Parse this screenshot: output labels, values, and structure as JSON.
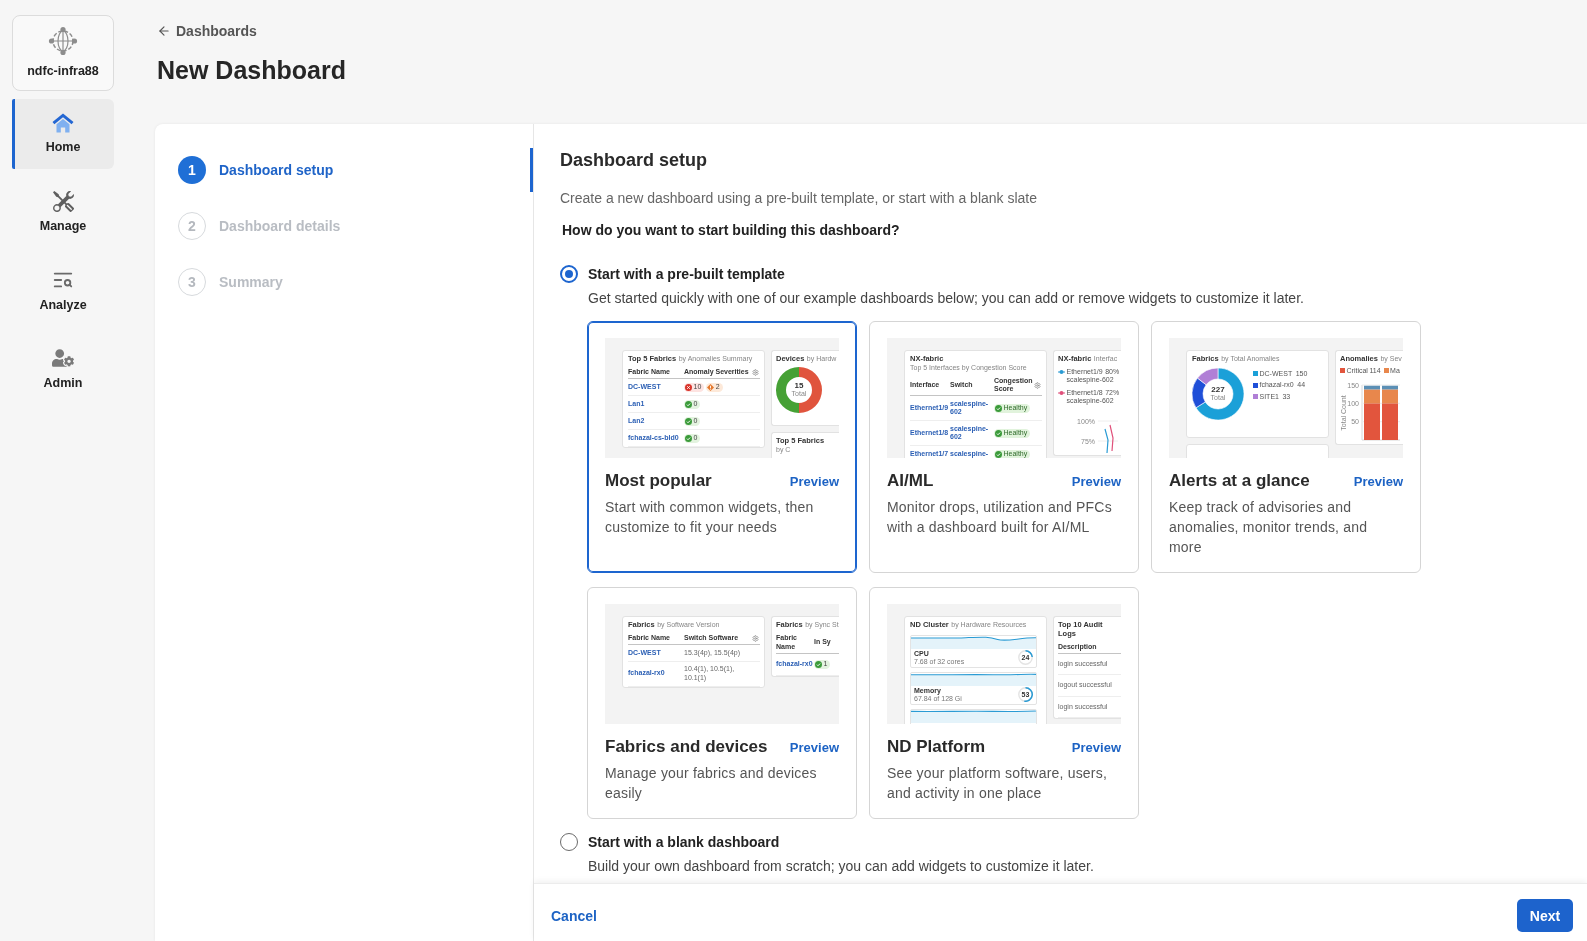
{
  "sidebar": {
    "site": "ndfc-infra88",
    "items": [
      {
        "label": "Home",
        "selected": true
      },
      {
        "label": "Manage",
        "selected": false
      },
      {
        "label": "Analyze",
        "selected": false
      },
      {
        "label": "Admin",
        "selected": false
      }
    ]
  },
  "header": {
    "back_link": "Dashboards",
    "title": "New Dashboard"
  },
  "steps": [
    {
      "number": "1",
      "label": "Dashboard setup",
      "selected": true
    },
    {
      "number": "2",
      "label": "Dashboard details",
      "selected": false
    },
    {
      "number": "3",
      "label": "Summary",
      "selected": false
    }
  ],
  "setup": {
    "title": "Dashboard setup",
    "description": "Create a new dashboard using a pre-built template, or start with a blank slate",
    "question": "How do you want to start building this dashboard?",
    "options": [
      {
        "label": "Start with a pre-built template",
        "description": "Get started quickly with one of our example dashboards below; you can add or remove widgets to customize it later.",
        "selected": true,
        "templates": [
          {
            "title": "Most popular",
            "preview_link": "Preview",
            "description": "Start with common widgets, then customize to fit your needs",
            "selected": true,
            "thumbnail": {
              "columns": [
                {
                  "widgets": [
                    {
                      "kind": "table",
                      "title": "Top 5 Fabrics",
                      "subtitle": "by Anomalies Summary",
                      "menu_icon": true,
                      "columns": [
                        "Fabric Name",
                        "Anomaly Severities"
                      ],
                      "rows": [
                        {
                          "cells": [
                            {
                              "kind": "link",
                              "text": "DC-WEST"
                            },
                            {
                              "kind": "badges",
                              "badges": [
                                {
                                  "kind": "critical",
                                  "text": "10"
                                },
                                {
                                  "kind": "major",
                                  "text": "2"
                                }
                              ]
                            }
                          ]
                        },
                        {
                          "cells": [
                            {
                              "kind": "link",
                              "text": "Lan1"
                            },
                            {
                              "kind": "badges",
                              "badges": [
                                {
                                  "kind": "healthy",
                                  "text": "0"
                                }
                              ]
                            }
                          ]
                        },
                        {
                          "cells": [
                            {
                              "kind": "link",
                              "text": "Lan2"
                            },
                            {
                              "kind": "badges",
                              "badges": [
                                {
                                  "kind": "healthy",
                                  "text": "0"
                                }
                              ]
                            }
                          ]
                        },
                        {
                          "cells": [
                            {
                              "kind": "link",
                              "text": "fchazal-cs-bld0"
                            },
                            {
                              "kind": "badges",
                              "badges": [
                                {
                                  "kind": "healthy",
                                  "text": "0"
                                }
                              ]
                            }
                          ]
                        }
                      ]
                    }
                  ]
                },
                {
                  "widgets": [
                    {
                      "kind": "donut",
                      "title": "Devices",
                      "subtitle": "by Hardw",
                      "total": "15",
                      "total_label": "Total"
                    },
                    {
                      "kind": "stub",
                      "title": "Top 5 Fabrics",
                      "subtitle": "by C"
                    }
                  ]
                }
              ]
            }
          },
          {
            "title": "AI/ML",
            "preview_link": "Preview",
            "description": "Monitor drops, utilization and PFCs with a dashboard built for AI/ML",
            "selected": false,
            "thumbnail": {
              "columns": [
                {
                  "widgets": [
                    {
                      "kind": "table",
                      "title": "NX-fabric",
                      "subtitle": "Top 5 Interfaces by Congestion Score",
                      "menu_icon": true,
                      "columns": [
                        "Interface",
                        "Switch",
                        "Congestion Score"
                      ],
                      "rows": [
                        {
                          "cells": [
                            {
                              "kind": "link",
                              "text": "Ethernet1/9"
                            },
                            {
                              "kind": "link",
                              "text": "scalespine-602"
                            },
                            {
                              "kind": "status",
                              "text": "Healthy"
                            }
                          ]
                        },
                        {
                          "cells": [
                            {
                              "kind": "link",
                              "text": "Ethernet1/8"
                            },
                            {
                              "kind": "link",
                              "text": "scalespine-602"
                            },
                            {
                              "kind": "status",
                              "text": "Healthy"
                            }
                          ]
                        },
                        {
                          "cells": [
                            {
                              "kind": "link",
                              "text": "Ethernet1/7"
                            },
                            {
                              "kind": "link",
                              "text": "scalespine-"
                            },
                            {
                              "kind": "status",
                              "text": "Healthy"
                            }
                          ]
                        }
                      ]
                    }
                  ]
                },
                {
                  "widgets": [
                    {
                      "kind": "lines",
                      "title": "NX-fabric",
                      "subtitle": "Interfac",
                      "legend": [
                        {
                          "label": "Ethernet1/9",
                          "value": "80%",
                          "detail": "scalespine-602",
                          "color": "#2a9bd4"
                        },
                        {
                          "label": "Ethernet1/8",
                          "value": "72%",
                          "detail": "scalespine-602",
                          "color": "#e0507a"
                        }
                      ],
                      "axis_labels": [
                        "100%",
                        "75%"
                      ]
                    }
                  ]
                }
              ]
            }
          },
          {
            "title": "Alerts at a glance",
            "preview_link": "Preview",
            "description": "Keep track of advisories and anomalies, monitor trends, and more",
            "selected": false,
            "thumbnail": {
              "columns": [
                {
                  "widgets": [
                    {
                      "kind": "donut_chart",
                      "title": "Fabrics",
                      "subtitle": "by Total Anomalies",
                      "total": "227",
                      "total_label": "Total",
                      "legend": [
                        {
                          "label": "DC-WEST",
                          "value": "150",
                          "color": "#1ba0d8"
                        },
                        {
                          "label": "fchazal-rx0",
                          "value": "44",
                          "color": "#1f4fd8"
                        },
                        {
                          "label": "SITE1",
                          "value": "33",
                          "color": "#b07fd6"
                        }
                      ],
                      "chart_data": {
                        "type": "donut",
                        "values": [
                          66.1,
                          19.4,
                          14.5
                        ]
                      }
                    },
                    {
                      "kind": "stub"
                    }
                  ]
                },
                {
                  "widgets": [
                    {
                      "kind": "bars",
                      "title": "Anomalies",
                      "subtitle": "by Sev",
                      "legend": [
                        {
                          "label": "Critical",
                          "value": "114",
                          "color": "#e2553d"
                        },
                        {
                          "label": "Ma",
                          "color": "#e8874c"
                        }
                      ],
                      "chart_data": {
                        "type": "bar",
                        "stacked": true,
                        "grid": true,
                        "ylabel": "Total Count",
                        "ylim": [
                          0,
                          150
                        ],
                        "yticks": [
                          50,
                          100,
                          150
                        ],
                        "series": [
                          {
                            "color": "#e2553d",
                            "values": [
                              100,
                              100
                            ]
                          },
                          {
                            "color": "#e8874c",
                            "values": [
                              38,
                              38
                            ]
                          },
                          {
                            "color": "#5b8fb5",
                            "values": [
                              10,
                              10
                            ]
                          }
                        ]
                      }
                    }
                  ]
                }
              ]
            }
          },
          {
            "title": "Fabrics and devices",
            "preview_link": "Preview",
            "description": "Manage your fabrics and devices easily",
            "selected": false,
            "thumbnail": {
              "columns": [
                {
                  "widgets": [
                    {
                      "kind": "table",
                      "title": "Fabrics",
                      "subtitle": "by Software Version",
                      "menu_icon": true,
                      "columns": [
                        "Fabric Name",
                        "Switch Software"
                      ],
                      "rows": [
                        {
                          "cells": [
                            {
                              "kind": "link",
                              "text": "DC-WEST"
                            },
                            {
                              "kind": "text",
                              "text": "15.3(4p), 15.5(4p)"
                            }
                          ]
                        },
                        {
                          "cells": [
                            {
                              "kind": "link",
                              "text": "fchazal-rx0"
                            },
                            {
                              "kind": "text",
                              "text": "10.4(1), 10.5(1), 10.1(1)"
                            }
                          ]
                        }
                      ]
                    }
                  ]
                },
                {
                  "widgets": [
                    {
                      "kind": "table",
                      "title": "Fabrics",
                      "subtitle": "by Sync St",
                      "columns": [
                        "Fabric Name",
                        "In Sy"
                      ],
                      "rows": [
                        {
                          "cells": [
                            {
                              "kind": "link",
                              "text": "fchazal-rx0"
                            },
                            {
                              "kind": "badges",
                              "badges": [
                                {
                                  "kind": "healthy",
                                  "text": "1"
                                }
                              ]
                            }
                          ]
                        }
                      ]
                    }
                  ]
                }
              ]
            }
          },
          {
            "title": "ND Platform",
            "preview_link": "Preview",
            "description": "See your platform software, users, and activity in one place",
            "selected": false,
            "thumbnail": {
              "columns": [
                {
                  "widgets": [
                    {
                      "kind": "metrics",
                      "title": "ND Cluster",
                      "subtitle": "by Hardware Resources",
                      "tiles": [
                        {
                          "kind": "tile",
                          "label": "CPU",
                          "detail": "7.68 of 32 cores",
                          "value": "24"
                        },
                        {
                          "kind": "tile",
                          "label": "Memory",
                          "detail": "67.84 of 128 Gi",
                          "value": "53"
                        },
                        {
                          "kind": "edge"
                        }
                      ]
                    }
                  ]
                },
                {
                  "widgets": [
                    {
                      "kind": "table",
                      "title": "Top 10 Audit Logs",
                      "columns": [
                        "Description"
                      ],
                      "rows": [
                        {
                          "cells": [
                            {
                              "kind": "text",
                              "text": "login successful"
                            }
                          ]
                        },
                        {
                          "cells": [
                            {
                              "kind": "text",
                              "text": "logout successful"
                            }
                          ]
                        },
                        {
                          "cells": [
                            {
                              "kind": "text",
                              "text": "login successful"
                            }
                          ]
                        }
                      ]
                    }
                  ]
                }
              ]
            }
          }
        ]
      },
      {
        "label": "Start with a blank dashboard",
        "description": "Build your own dashboard from scratch; you can add widgets to customize it later.",
        "selected": false
      }
    ]
  },
  "footer": {
    "cancel": "Cancel",
    "next": "Next"
  }
}
